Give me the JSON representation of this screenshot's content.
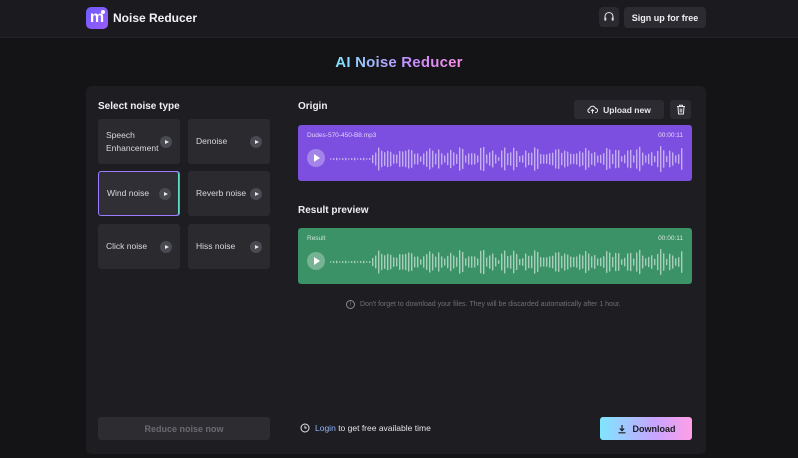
{
  "header": {
    "logo_letter": "m",
    "app_title": "Noise Reducer",
    "signup_label": "Sign up for free"
  },
  "page_title": "AI Noise Reducer",
  "left_panel": {
    "title": "Select noise type",
    "noise_types": [
      {
        "label": "Speech Enhancement",
        "selected": false
      },
      {
        "label": "Denoise",
        "selected": false
      },
      {
        "label": "Wind noise",
        "selected": true
      },
      {
        "label": "Reverb noise",
        "selected": false
      },
      {
        "label": "Click noise",
        "selected": false
      },
      {
        "label": "Hiss noise",
        "selected": false
      }
    ],
    "reduce_button": "Reduce noise now"
  },
  "origin": {
    "title": "Origin",
    "upload_label": "Upload new",
    "file_name": "Dudes-570-450-B8.mp3",
    "time": "00:00:11"
  },
  "result": {
    "title": "Result preview",
    "file_name": "Result",
    "time": "00:00:11"
  },
  "notice": "Don't forget to download your files. They will be discarded automatically after 1 hour.",
  "login": {
    "link": "Login",
    "text": "to get free available time"
  },
  "download_label": "Download",
  "colors": {
    "origin_player": "#7c4fe0",
    "result_player": "#3a9266",
    "selected_border": "#9b7bff"
  }
}
